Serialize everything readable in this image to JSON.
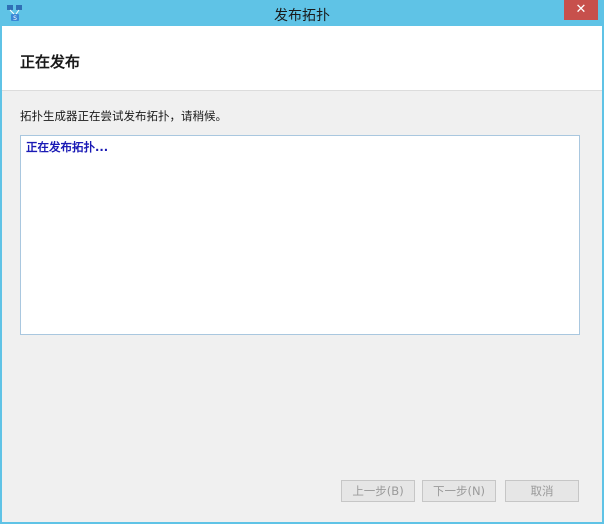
{
  "window": {
    "title": "发布拓扑",
    "close_label": "✕"
  },
  "header": {
    "title": "正在发布"
  },
  "main": {
    "description": "拓扑生成器正在尝试发布拓扑，请稍候。",
    "log_text": "正在发布拓扑..."
  },
  "footer": {
    "prev_label": "上一步(B)",
    "next_label": "下一步(N)",
    "cancel_label": "取消"
  },
  "colors": {
    "titlebar": "#5fc3e6",
    "close": "#c7504c",
    "log_text": "#1a1ab5"
  }
}
